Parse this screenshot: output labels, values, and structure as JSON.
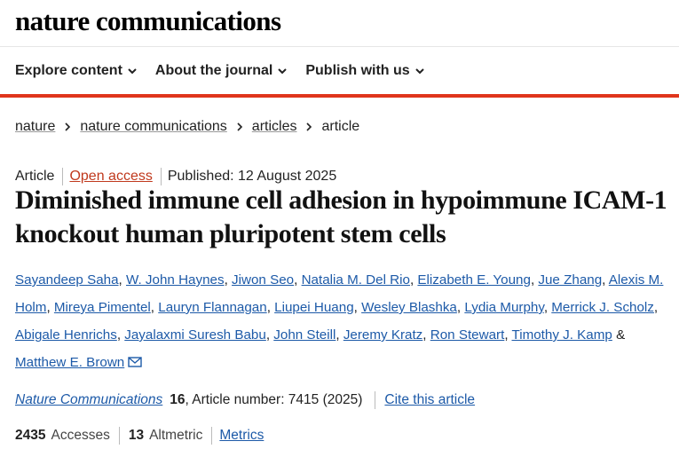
{
  "site": {
    "logo": "nature communications"
  },
  "nav": {
    "items": [
      {
        "label": "Explore content"
      },
      {
        "label": "About the journal"
      },
      {
        "label": "Publish with us"
      }
    ]
  },
  "colors": {
    "accent_red": "#e0351c",
    "link_blue": "#1d5aa8",
    "open_access": "#c0391d"
  },
  "breadcrumb": {
    "items": [
      "nature",
      "nature communications",
      "articles",
      "article"
    ]
  },
  "article": {
    "type": "Article",
    "access": "Open access",
    "published": "Published: 12 August 2025",
    "title": "Diminished immune cell adhesion in hypoimmune ICAM-1 knockout human pluripotent stem cells",
    "authors": [
      "Sayandeep Saha",
      "W. John Haynes",
      "Jiwon Seo",
      "Natalia M. Del Rio",
      "Elizabeth E. Young",
      "Jue Zhang",
      "Alexis M. Holm",
      "Mireya Pimentel",
      "Lauryn Flannagan",
      "Liupei Huang",
      "Wesley Blashka",
      "Lydia Murphy",
      "Merrick J. Scholz",
      "Abigale Henrichs",
      "Jayalaxmi Suresh Babu",
      "John Steill",
      "Jeremy Kratz",
      "Ron Stewart",
      "Timothy J. Kamp",
      "Matthew E. Brown"
    ],
    "author_separator": ", ",
    "author_last_joiner": " & ",
    "journal": "Nature Communications",
    "volume": "16",
    "article_number": ", Article number: 7415 (2025)",
    "cite_label": "Cite this article",
    "accesses_count": "2435",
    "accesses_label": "Accesses",
    "altmetric_count": "13",
    "altmetric_label": "Altmetric",
    "metrics_label": "Metrics"
  }
}
